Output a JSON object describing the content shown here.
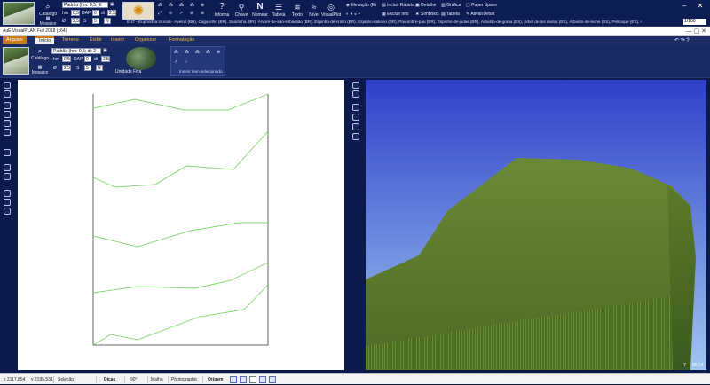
{
  "top_toolbar": {
    "catalog_label": "Catálogo",
    "mosaic_label": "Mosaico",
    "selected_plant": "Padrão (hm: 0,5; di",
    "fields": {
      "hm_label": "hm",
      "hm_value": "0,5",
      "dap_label": "DAP",
      "dap_value": "0",
      "di_label": "di",
      "di_value": "2,5",
      "phi_label": "Ø",
      "phi_value": "2,5",
      "s_label": "S",
      "s_value": "5",
      "n_label": "N",
      "n_value": "N"
    },
    "buttons": [
      {
        "label": "Informa",
        "icon": "info-icon"
      },
      {
        "label": "Chave",
        "icon": "key-icon"
      },
      {
        "label": "Nomear",
        "icon": "name-icon"
      },
      {
        "label": "Tabela",
        "icon": "table-icon"
      },
      {
        "label": "Texto",
        "icon": "text-icon"
      },
      {
        "label": "Nível",
        "icon": "level-icon"
      },
      {
        "label": "VisualPlot",
        "icon": "plot-icon"
      }
    ],
    "right_items": [
      "Elevação (E)",
      "Incluir Rápido",
      "Detalhe",
      "Gráfica",
      "Paper Space",
      "Excluir info",
      "Símbolos",
      "Tabela",
      "Ativar/Desat"
    ],
    "zoom": "1/100",
    "plant_list": "EUT - Euphorbia tirucalli - Aveloz (BR), Caga-olho (BR), Saúdinha (BR), Árvore-de-são-sebastião (BR), Espinho-de-cristo (BR), Espinho-italiano (BR), Pau-sobre-pau (BR), Espinho-de-judas (BR), Árbusto-de-goma (ES), Árbol de los dedos (ES), Árbusto-de-leche (ES), Pelitoque (ES), Alitá (ES)"
  },
  "window": {
    "title": "AuE VisualPLAN Full 2018 (x64)"
  },
  "tabs": [
    "Arquivo",
    "Início",
    "Terreno",
    "Exibir",
    "Inserir",
    "Organizar",
    "Formatação"
  ],
  "ribbon": {
    "catalog_label": "Catálogo",
    "mosaic_label": "Mosaico",
    "selected_plant": "Padrão (hm: 0,5; di: 2",
    "unit_label": "Unidade Fixa",
    "group_label": "Inserir item selecionado",
    "fields": {
      "hm_label": "hm",
      "hm_value": "0,5",
      "dap_label": "DAP",
      "dap_value": "0",
      "di_label": "di",
      "di_value": "2,5",
      "phi_label": "Ø",
      "phi_value": "2,5",
      "s_label": "S",
      "s_value": "5",
      "n_label": "N",
      "n_value": "N"
    }
  },
  "view3d": {
    "corner_left": "7",
    "corner_right": "85,74"
  },
  "statusbar": {
    "x": "x 2117,854",
    "y": "y 2195,531",
    "mode": "Seleção",
    "dicas": "Dicas",
    "angle": "90°",
    "malha": "Malha",
    "photographic": "Photographic",
    "origem": "Origem"
  },
  "colors": {
    "chrome": "#0d1c52",
    "accent": "#c77b1a",
    "contour": "#7fd66b",
    "sky_top": "#2f3fc9",
    "sky_bottom": "#9fc6ef",
    "terrain": "#5c7a2e"
  }
}
